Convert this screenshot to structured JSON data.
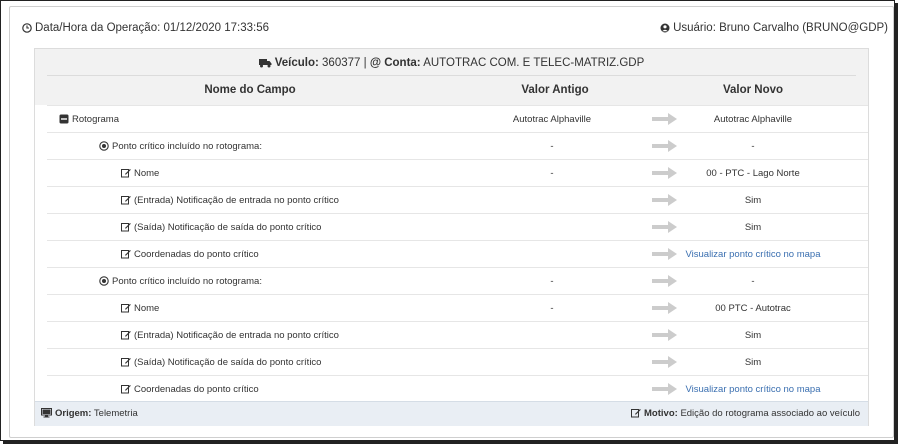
{
  "header": {
    "operation_label": "Data/Hora da Operação:",
    "operation_value": "01/12/2020 17:33:56",
    "user_label": "Usuário:",
    "user_value": "Bruno Carvalho (BRUNO@GDP)"
  },
  "summary": {
    "vehicle_label": "Veículo:",
    "vehicle_value": "360377",
    "separator": "|",
    "account_label": "@ Conta:",
    "account_value": "AUTOTRAC COM. E TELEC-MATRIZ.GDP"
  },
  "columns": {
    "field": "Nome do Campo",
    "old": "Valor Antigo",
    "new": "Valor Novo"
  },
  "rows": [
    {
      "name": "Rotograma",
      "old": "Autotrac Alphaville",
      "new": "Autotrac Alphaville",
      "icon": "minus-square-icon"
    },
    {
      "name": "Ponto crítico incluído no rotograma:",
      "old": "-",
      "new": "-",
      "icon": "dot-circle-icon"
    },
    {
      "name": "Nome",
      "old": "-",
      "new": "00 - PTC - Lago Norte",
      "icon": "edit-icon"
    },
    {
      "name": "(Entrada) Notificação de entrada no ponto crítico",
      "old": "",
      "new": "Sim",
      "icon": "edit-icon"
    },
    {
      "name": "(Saída) Notificação de saída do ponto crítico",
      "old": "",
      "new": "Sim",
      "icon": "edit-icon"
    },
    {
      "name": "Coordenadas do ponto crítico",
      "old": "",
      "new": "Visualizar ponto crítico no mapa",
      "icon": "edit-icon",
      "link": true
    },
    {
      "name": "Ponto crítico incluído no rotograma:",
      "old": "-",
      "new": "-",
      "icon": "dot-circle-icon"
    },
    {
      "name": "Nome",
      "old": "-",
      "new": "00 PTC - Autotrac",
      "icon": "edit-icon"
    },
    {
      "name": "(Entrada) Notificação de entrada no ponto crítico",
      "old": "",
      "new": "Sim",
      "icon": "edit-icon"
    },
    {
      "name": "(Saída) Notificação de saída do ponto crítico",
      "old": "",
      "new": "Sim",
      "icon": "edit-icon"
    },
    {
      "name": "Coordenadas do ponto crítico",
      "old": "",
      "new": "Visualizar ponto crítico no mapa",
      "icon": "edit-icon",
      "link": true
    }
  ],
  "footer": {
    "origin_label": "Origem:",
    "origin_value": "Telemetria",
    "reason_label": "Motivo:",
    "reason_value": "Edição do rotograma associado ao veículo"
  },
  "colors": {
    "link": "#3a6fb0",
    "footer_bg": "#e9eef4",
    "header_bg": "#f2f2f2",
    "arrow": "#cccccc"
  }
}
